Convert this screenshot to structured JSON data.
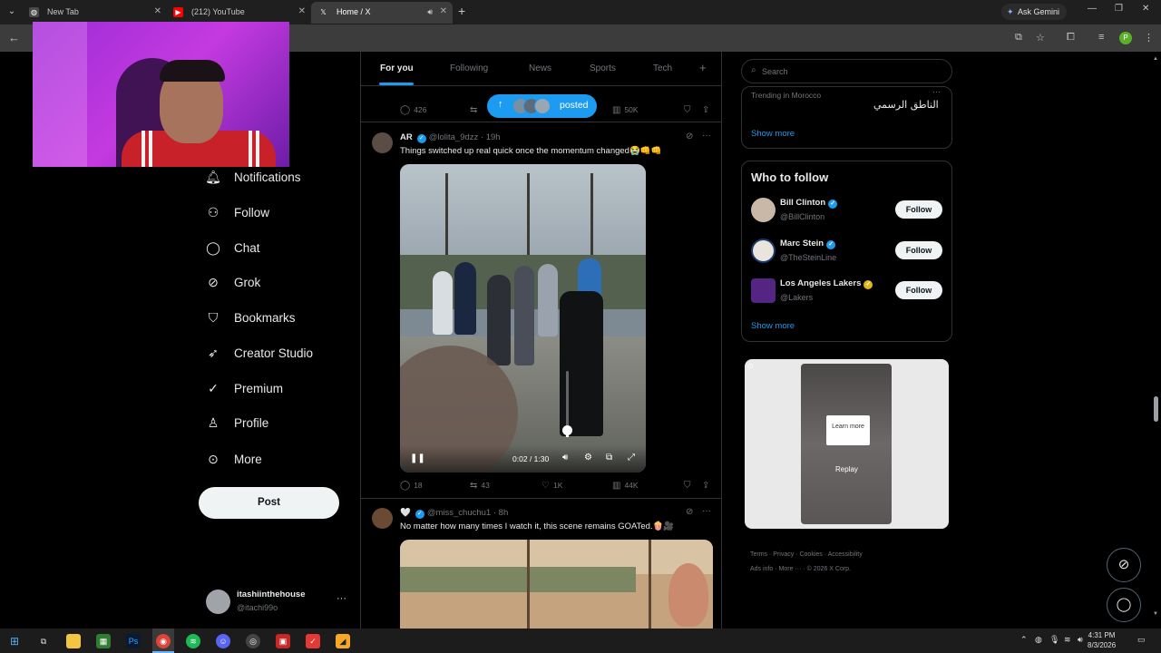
{
  "browser": {
    "tabs": [
      {
        "label": "New Tab",
        "icon": "chrome-icon"
      },
      {
        "label": "(212) YouTube",
        "icon": "youtube-icon"
      },
      {
        "label": "Home / X",
        "icon": "x-icon"
      }
    ],
    "gemini_label": "Ask Gemini"
  },
  "nav": {
    "items": [
      {
        "label": "Notifications",
        "icon": "bell-icon"
      },
      {
        "label": "Follow",
        "icon": "person-plus-icon"
      },
      {
        "label": "Chat",
        "icon": "chat-icon"
      },
      {
        "label": "Grok",
        "icon": "grok-icon"
      },
      {
        "label": "Bookmarks",
        "icon": "bookmark-icon"
      },
      {
        "label": "Creator Studio",
        "icon": "rocket-icon"
      },
      {
        "label": "Premium",
        "icon": "verified-badge-icon"
      },
      {
        "label": "Profile",
        "icon": "person-icon"
      },
      {
        "label": "More",
        "icon": "ellipsis-circle-icon"
      }
    ],
    "post_label": "Post",
    "account": {
      "name": "itashiinthehouse",
      "handle": "@itachi99o"
    }
  },
  "feed": {
    "tabs": [
      "For you",
      "Following",
      "News",
      "Sports",
      "Tech"
    ],
    "posted_label": "posted",
    "prev_actions": {
      "replies": "426",
      "views": "50K"
    },
    "post1": {
      "name": "AR",
      "handle": "@lolita_9dzz",
      "time": "· 19h",
      "text": "Things switched up real quick once the momentum changed😭👊👊",
      "video_time": "0:02 / 1:30",
      "replies": "18",
      "reposts": "43",
      "likes": "1K",
      "views": "44K"
    },
    "post2": {
      "name": "🤍",
      "handle": "@miss_chuchu1",
      "time": "· 8h",
      "text": "No matter how many times I watch it, this scene remains GOATed.🍿🎥"
    }
  },
  "right": {
    "search_placeholder": "Search",
    "trend_label": "Trending in Morocco",
    "trend_name": "الناطق الرسمي",
    "show_more": "Show more",
    "who_to_follow": "Who to follow",
    "follow_label": "Follow",
    "suggestions": [
      {
        "name": "Bill Clinton",
        "handle": "@BillClinton",
        "badge": "blue"
      },
      {
        "name": "Marc Stein",
        "handle": "@TheSteinLine",
        "badge": "blue"
      },
      {
        "name": "Los Angeles Lakers",
        "handle": "@Lakers",
        "badge": "gold"
      }
    ],
    "ad": {
      "learn_more": "Learn more",
      "replay": "Replay"
    },
    "footer": [
      "Terms",
      "Privacy",
      "Cookies",
      "Accessibility",
      "Ads info",
      "More ···",
      "© 2026 X Corp."
    ]
  },
  "taskbar": {
    "time": "4:31 PM",
    "date": "8/3/2026"
  },
  "colors": {
    "accent": "#1d9bf0",
    "background": "#000000",
    "border": "#2f3336",
    "muted": "#71767b"
  }
}
